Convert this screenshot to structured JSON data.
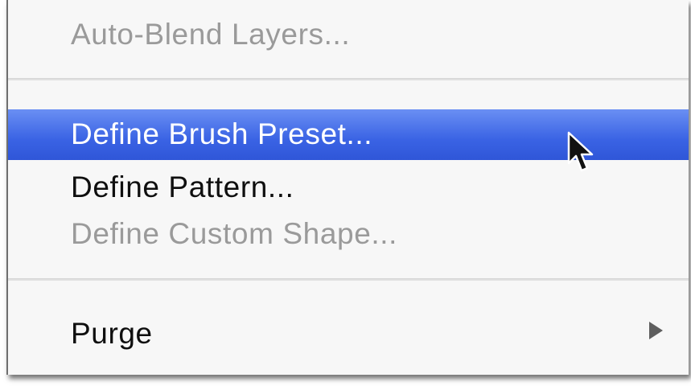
{
  "menu": {
    "items": [
      {
        "label": "Auto-Blend Layers...",
        "state": "disabled"
      },
      {
        "label": "Define Brush Preset...",
        "state": "highlighted"
      },
      {
        "label": "Define Pattern...",
        "state": "enabled"
      },
      {
        "label": "Define Custom Shape...",
        "state": "disabled"
      },
      {
        "label": "Purge",
        "state": "enabled",
        "submenu": true
      }
    ]
  },
  "icons": {
    "submenu": "submenu-arrow-icon",
    "pointer": "mouse-pointer-icon"
  },
  "colors": {
    "highlight": "#3a63e4",
    "disabled_text": "#9a9a9a",
    "menu_background": "#f7f7f7"
  }
}
